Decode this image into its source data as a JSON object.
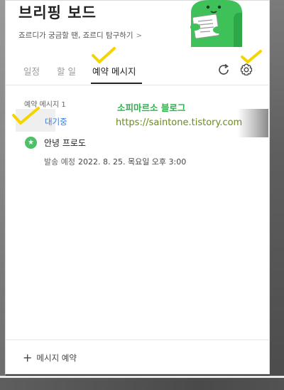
{
  "header": {
    "title": "브리핑 보드",
    "subtitle": "죠르디가 궁금할 땐, 죠르디 탐구하기",
    "subtitle_chevron": ">"
  },
  "tabs": [
    {
      "label": "일정"
    },
    {
      "label": "할 일"
    },
    {
      "label": "예약 메시지"
    }
  ],
  "icons": {
    "refresh": "refresh-icon",
    "settings": "gear-icon",
    "add": "plus-icon",
    "avatar": "star-avatar"
  },
  "colors": {
    "accent_blue": "#3a7bd5",
    "green": "#2db24a",
    "check_yellow": "#f5d400"
  },
  "reserved": {
    "section_label": "예약 메시지 1",
    "status": "대기중",
    "contact": "안녕 프로도",
    "avatar_glyph": "★",
    "send_label": "발송 예정",
    "send_datetime": "2022. 8. 25. 목요일 오후 3:00"
  },
  "watermark": {
    "title": "소피마르소 블로그",
    "url": "https://saintone.tistory.com"
  },
  "footer": {
    "add_label": "메시지 예약",
    "plus": "+"
  }
}
